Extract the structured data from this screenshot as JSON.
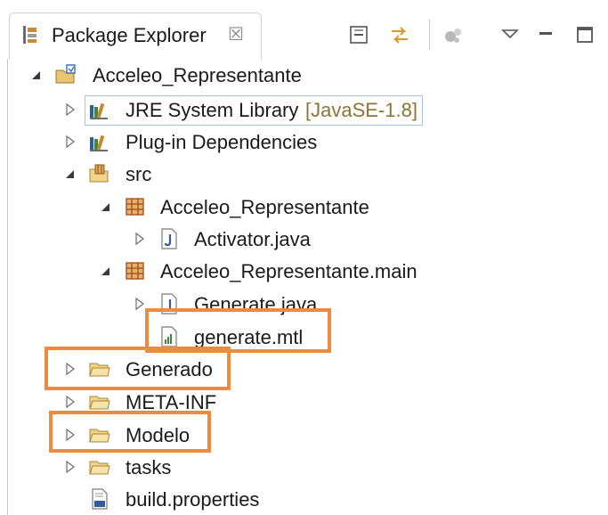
{
  "tab": {
    "title": "Package Explorer",
    "close_glyph": "☒"
  },
  "toolbar": {
    "buttons": [
      "collapse-all-icon",
      "link-with-editor-icon",
      "focus-on-active-task-icon",
      "view-menu-icon",
      "minimize-icon",
      "maximize-icon"
    ]
  },
  "tree": {
    "project": "Acceleo_Representante",
    "jre_label": "JRE System Library",
    "jre_decoration": "[JavaSE-1.8]",
    "plugin_deps": "Plug-in Dependencies",
    "src": "src",
    "pkg1": "Acceleo_Representante",
    "activator": "Activator.java",
    "pkg2": "Acceleo_Representante.main",
    "generate_java": "Generate.java",
    "generate_mtl": "generate.mtl",
    "generado": "Generado",
    "meta_inf": "META-INF",
    "modelo": "Modelo",
    "tasks": "tasks",
    "build_properties": "build.properties"
  },
  "colors": {
    "highlight": "#f08a3e",
    "folder": "#f1d48a",
    "package": "#b86a2e",
    "decoration": "#8d7335"
  }
}
